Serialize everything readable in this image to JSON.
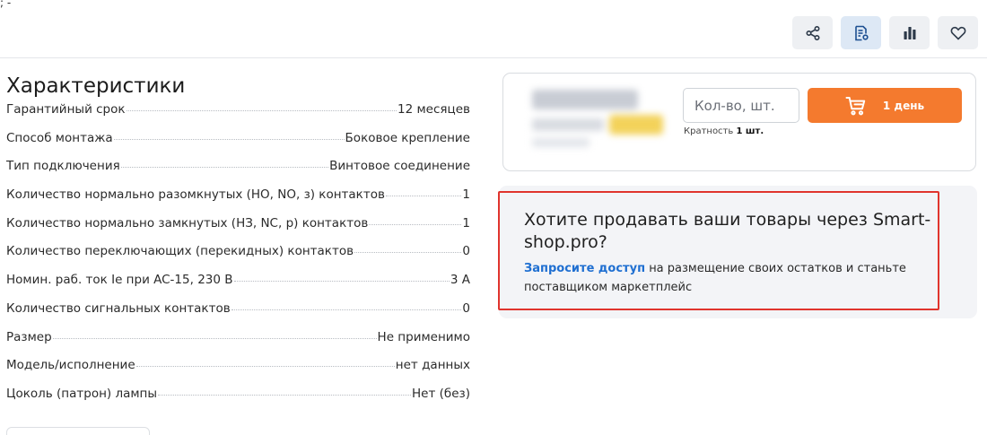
{
  "corner_mark": "; -",
  "toolbar": {
    "buttons": [
      {
        "name": "share-button",
        "icon": "share-icon"
      },
      {
        "name": "document-settings-button",
        "icon": "document-gear-icon"
      },
      {
        "name": "compare-button",
        "icon": "bar-chart-icon"
      },
      {
        "name": "favorite-button",
        "icon": "heart-icon"
      }
    ]
  },
  "specs": {
    "title": "Характеристики",
    "rows": [
      {
        "name": "Гарантийный срок",
        "value": "12 месяцев"
      },
      {
        "name": "Способ монтажа",
        "value": "Боковое крепление"
      },
      {
        "name": "Тип подключения",
        "value": "Винтовое соединение"
      },
      {
        "name": "Количество нормально разомкнутых (НО, NO, з) контактов",
        "value": "1"
      },
      {
        "name": "Количество нормально замкнутых (НЗ, NC, р) контактов",
        "value": "1"
      },
      {
        "name": "Количество переключающих (перекидных) контактов",
        "value": "0"
      },
      {
        "name": "Номин. раб. ток Ie при AC-15, 230 В",
        "value": "3 A"
      },
      {
        "name": "Количество сигнальных контактов",
        "value": "0"
      },
      {
        "name": "Размер",
        "value": "Не применимо"
      },
      {
        "name": "Модель/исполнение",
        "value": "нет данных"
      },
      {
        "name": "Цоколь (патрон) лампы",
        "value": "Нет (без)"
      }
    ]
  },
  "buy": {
    "qty_placeholder": "Кол-во, шт.",
    "button_label": "1 день",
    "multiplicity_prefix": "Кратность",
    "multiplicity_value": "1 шт.",
    "accent_color": "#f47a2e"
  },
  "promo": {
    "title": "Хотите продавать ваши товары через Smart-shop.pro?",
    "link": "Запросите доступ",
    "text": "на размещение своих остатков и станьте поставщиком маркетплейс",
    "frame_color": "#e0342d"
  }
}
